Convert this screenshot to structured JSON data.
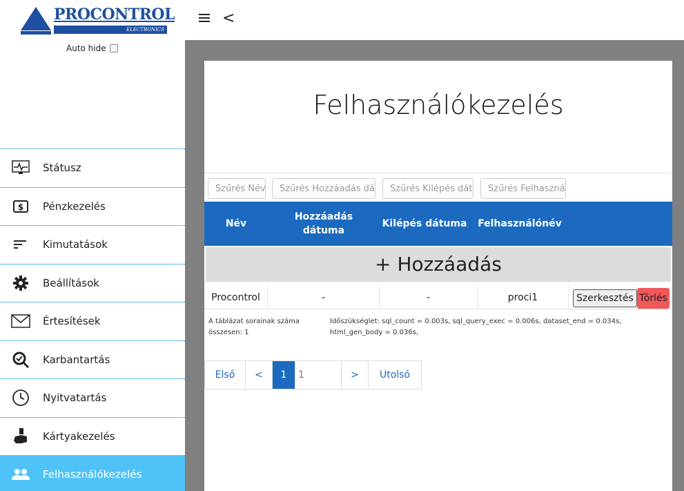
{
  "logo": {
    "brand": "PROCONTROL",
    "subtitle": "ELECTRONICS"
  },
  "sidebar": {
    "auto_hide_label": "Auto hide",
    "items": [
      {
        "label": "Státusz",
        "icon": "monitor-pulse-icon"
      },
      {
        "label": "Pénzkezelés",
        "icon": "dollar-icon"
      },
      {
        "label": "Kimutatások",
        "icon": "sort-lines-icon"
      },
      {
        "label": "Beállítások",
        "icon": "gear-icon"
      },
      {
        "label": "Értesítések",
        "icon": "envelope-icon"
      },
      {
        "label": "Karbantartás",
        "icon": "search-check-icon"
      },
      {
        "label": "Nyitvatartás",
        "icon": "clock-icon"
      },
      {
        "label": "Kártyakezelés",
        "icon": "hand-card-icon"
      },
      {
        "label": "Felhasználókezelés",
        "icon": "users-icon",
        "active": true
      }
    ]
  },
  "topbar": {
    "menu_icon": "hamburger-icon",
    "back_glyph": "<"
  },
  "page": {
    "title": "Felhasználókezelés",
    "filters": [
      {
        "placeholder": "Szűrés Név"
      },
      {
        "placeholder": "Szűrés Hozzáadás dátuma"
      },
      {
        "placeholder": "Szűrés Kilépés dátuma"
      },
      {
        "placeholder": "Szűrés Felhasználónév"
      }
    ],
    "columns": [
      "Név",
      "Hozzáadás dátuma",
      "Kilépés dátuma",
      "Felhasználónév"
    ],
    "add_label": "+ Hozzáadás",
    "rows": [
      {
        "name": "Procontrol",
        "added": "-",
        "left": "-",
        "username": "proci1"
      }
    ],
    "edit_label": "Szerkesztés",
    "delete_label": "Törlés",
    "row_count_text": "A táblázat sorainak száma összesen: 1",
    "timing_text": "Időszükséglet: sql_count = 0.003s, sql_query_exec = 0.006s, dataset_end = 0.034s, html_gen_body = 0.036s,",
    "pager": {
      "first": "Első",
      "prev": "<",
      "current": "1",
      "page_input": "1",
      "next": ">",
      "last": "Utolsó"
    }
  },
  "colors": {
    "primary": "#1b6ac0",
    "accent": "#4fc3f7",
    "danger": "#f0585a"
  }
}
